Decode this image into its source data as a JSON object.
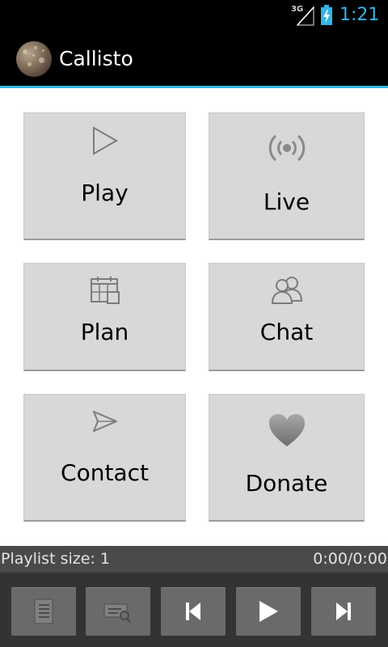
{
  "status_bar": {
    "network_label": "3G",
    "time": "1:21"
  },
  "app": {
    "title": "Callisto"
  },
  "menu": {
    "play_label": "Play",
    "live_label": "Live",
    "plan_label": "Plan",
    "chat_label": "Chat",
    "contact_label": "Contact",
    "donate_label": "Donate"
  },
  "player": {
    "playlist_size_text": "Playlist size: 1",
    "time_text": "0:00/0:00"
  },
  "colors": {
    "accent": "#33b5e5",
    "tile_background": "#d8d8d8",
    "player_button": "#6a6a6a"
  },
  "icons": {
    "play_tile": "play-outline-icon",
    "live_tile": "broadcast-icon",
    "plan_tile": "calendar-icon",
    "chat_tile": "people-icon",
    "contact_tile": "send-icon",
    "donate_tile": "heart-icon",
    "player": [
      "playlist-icon",
      "search-list-icon",
      "skip-previous-icon",
      "play-icon",
      "skip-next-icon"
    ]
  }
}
